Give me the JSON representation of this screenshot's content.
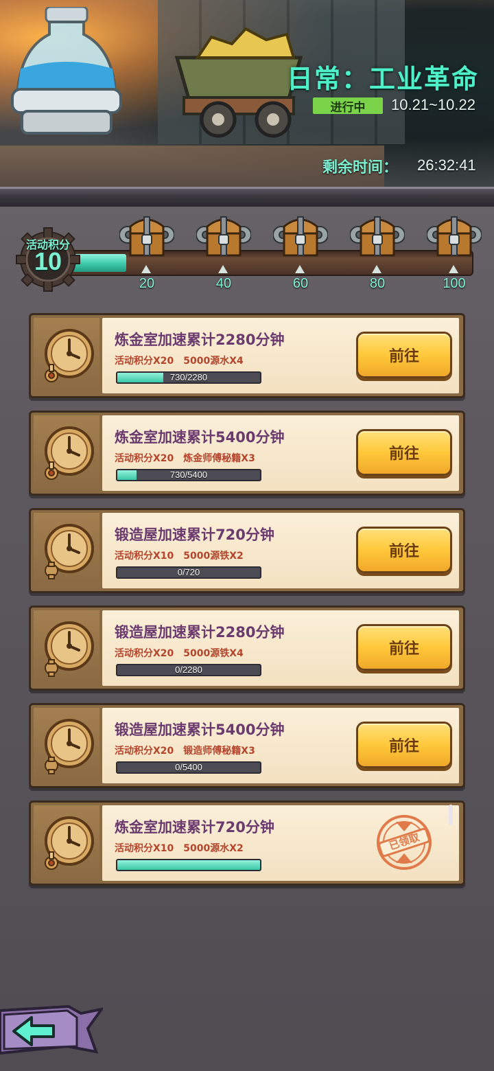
{
  "banner": {
    "title": "日常：工业革命",
    "status": "进行中",
    "date_range": "10.21~10.22",
    "remaining_label": "剩余时间：",
    "remaining_time": "26:32:41"
  },
  "score": {
    "label": "活动积分",
    "value": "10",
    "progress_fraction": 0.14
  },
  "milestones": [
    {
      "value": "20"
    },
    {
      "value": "40"
    },
    {
      "value": "60"
    },
    {
      "value": "80"
    },
    {
      "value": "100"
    }
  ],
  "tasks": [
    {
      "name": "炼金室加速累计2280分钟",
      "rewards": "活动积分X20　5000源水X4",
      "progress_text": "730/2280",
      "progress": 0.32,
      "action": "前往",
      "icon": "alchemy-clock-icon"
    },
    {
      "name": "炼金室加速累计5400分钟",
      "rewards": "活动积分X20　炼金师傅秘籍X3",
      "progress_text": "730/5400",
      "progress": 0.135,
      "action": "前往",
      "icon": "alchemy-clock-icon"
    },
    {
      "name": "锻造屋加速累计720分钟",
      "rewards": "活动积分X10　5000源铁X2",
      "progress_text": "0/720",
      "progress": 0,
      "action": "前往",
      "icon": "forge-clock-icon"
    },
    {
      "name": "锻造屋加速累计2280分钟",
      "rewards": "活动积分X20　5000源铁X4",
      "progress_text": "0/2280",
      "progress": 0,
      "action": "前往",
      "icon": "forge-clock-icon"
    },
    {
      "name": "锻造屋加速累计5400分钟",
      "rewards": "活动积分X20　锻造师傅秘籍X3",
      "progress_text": "0/5400",
      "progress": 0,
      "action": "前往",
      "icon": "forge-clock-icon"
    },
    {
      "name": "炼金室加速累计720分钟",
      "rewards": "活动积分X10　5000源水X2",
      "progress_text": "",
      "progress": 1,
      "claimed_label": "已领取",
      "icon": "alchemy-clock-icon"
    }
  ],
  "colors": {
    "accent": "#7df0d2",
    "progress_fill": "#3ac7a6",
    "button": "#ffc83a",
    "task_name": "#6a3a6e",
    "reward_text": "#b4452c"
  }
}
